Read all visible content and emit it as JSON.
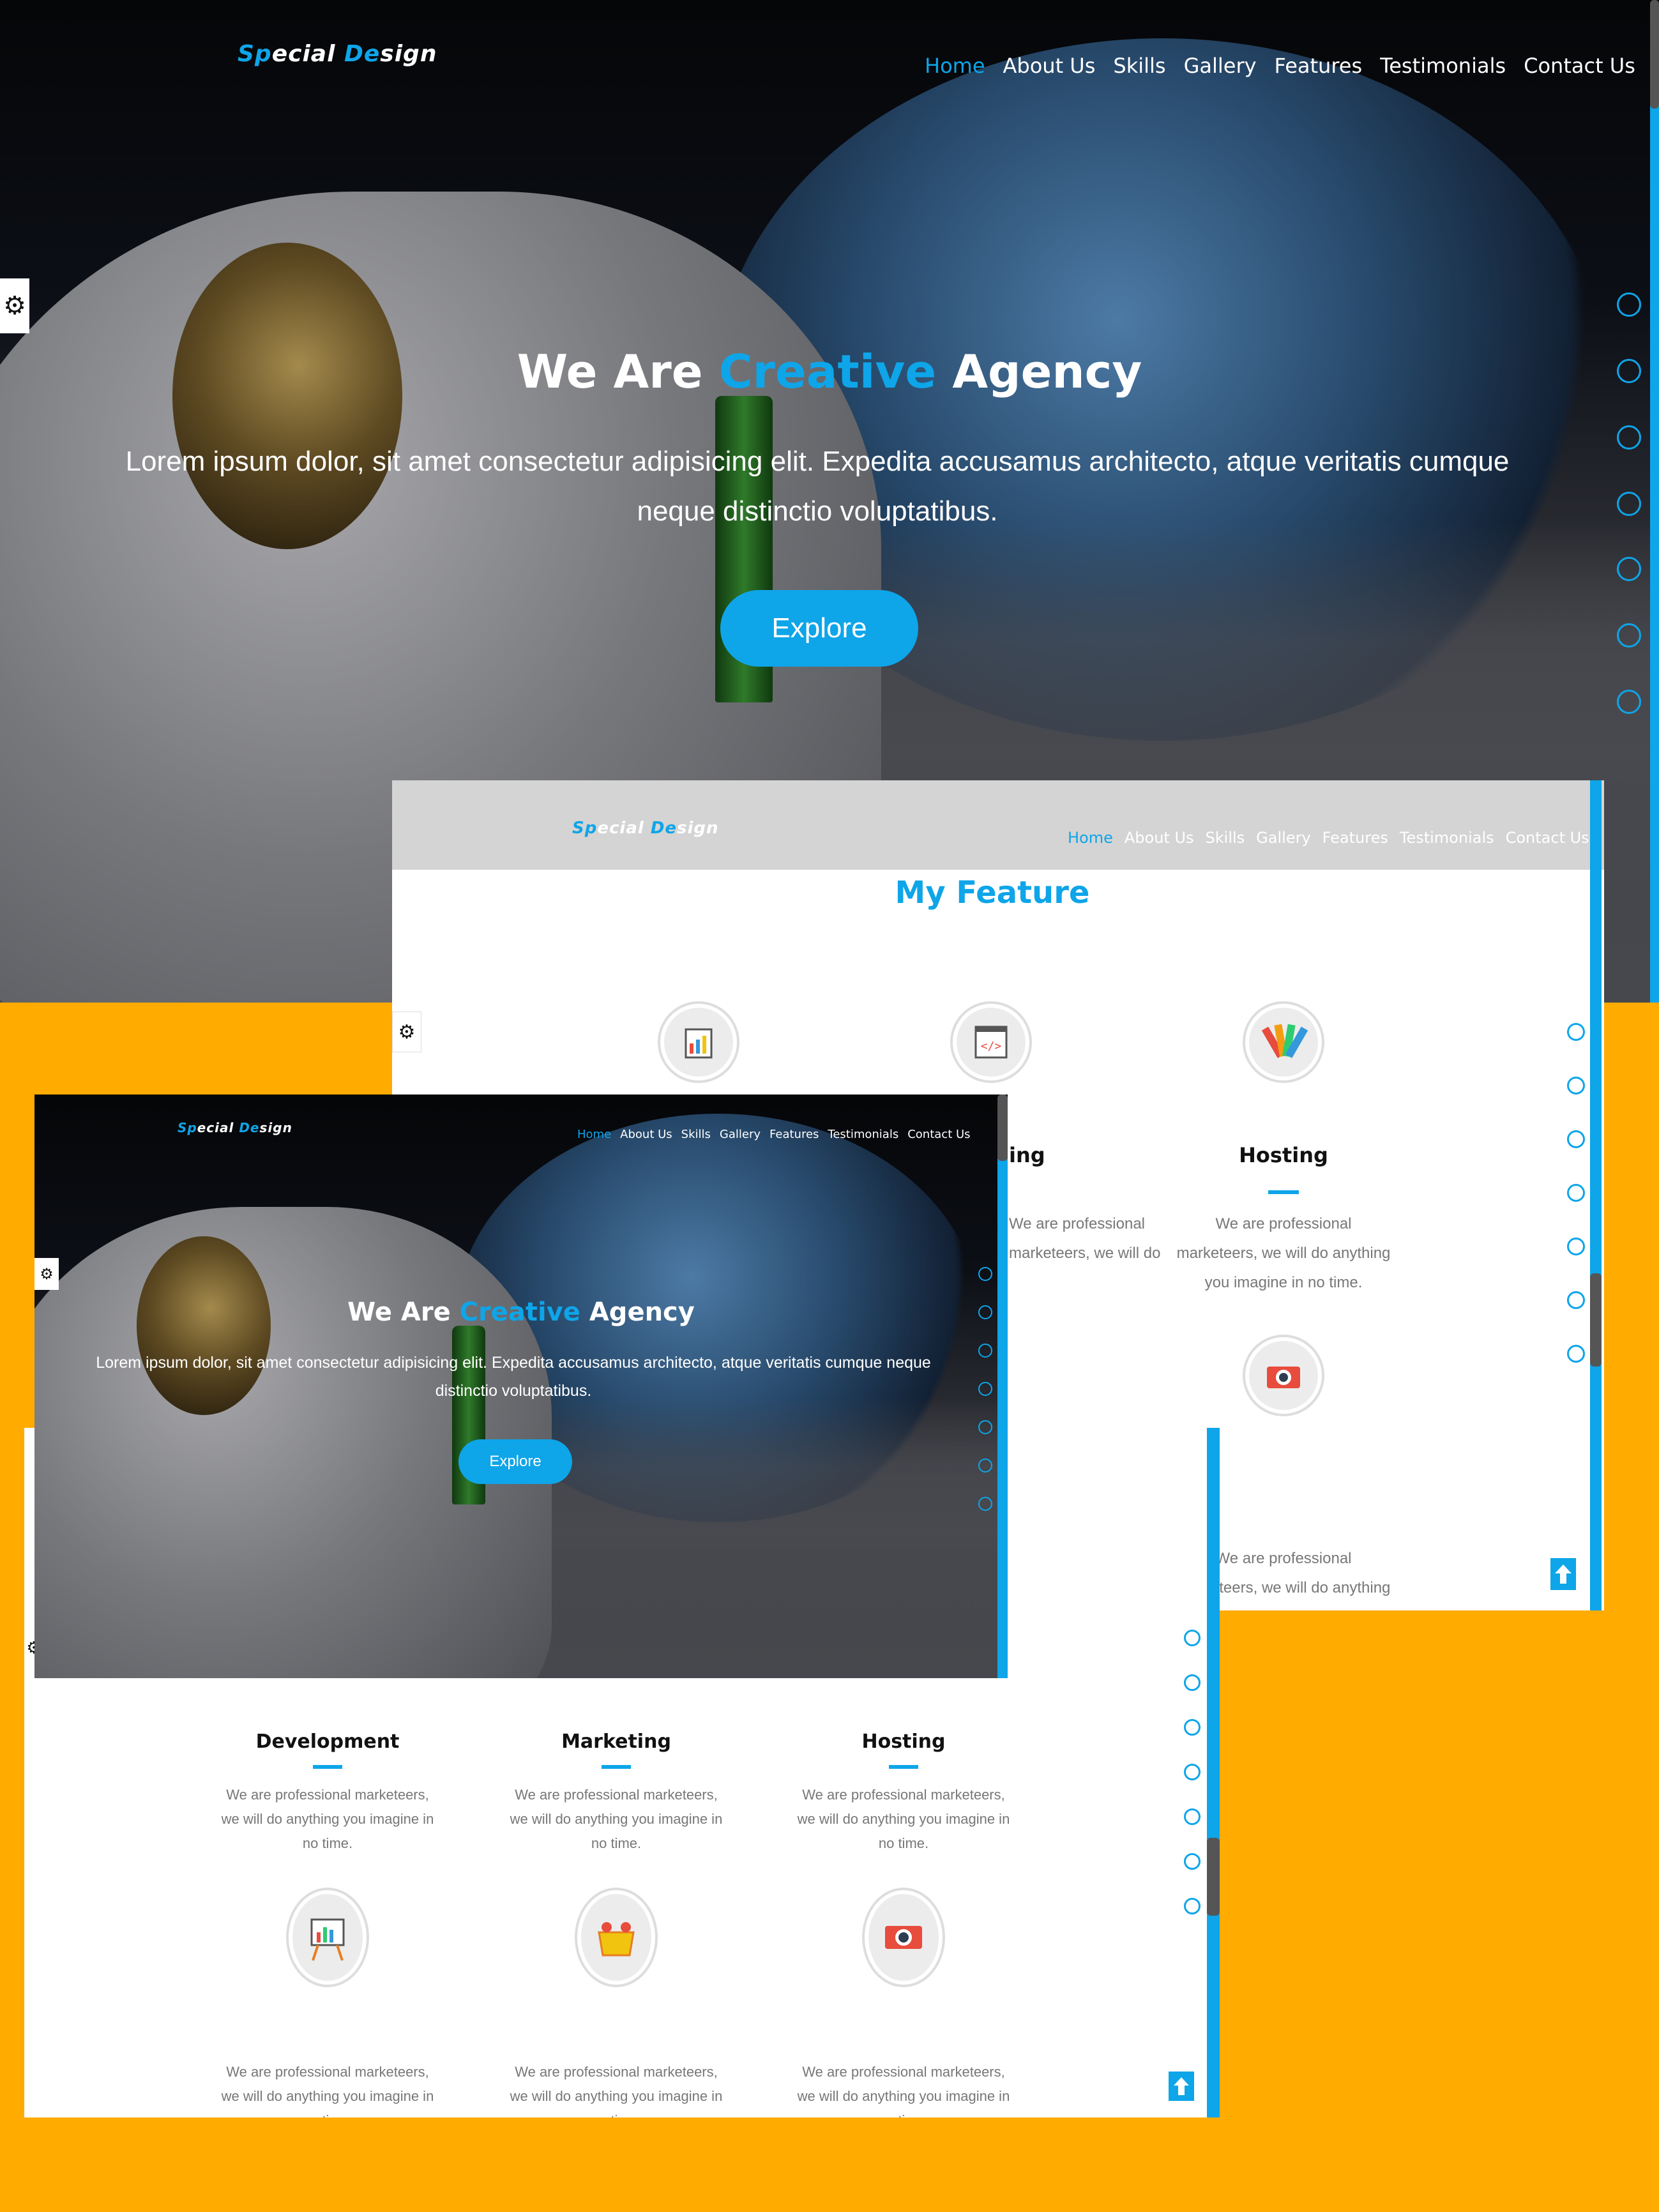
{
  "brand": {
    "logo_part1": "Sp",
    "logo_part2": "ecial ",
    "logo_part3": "De",
    "logo_part4": "sign",
    "accent": "#0ea5e9",
    "background": "#ffab00"
  },
  "nav": {
    "items": [
      "Home",
      "About Us",
      "Skills",
      "Gallery",
      "Features",
      "Testimonials",
      "Contact Us"
    ],
    "active": "Home"
  },
  "hero": {
    "title_part1": "We Are ",
    "title_accent": "Creative",
    "title_part2": " Agency",
    "description": "Lorem ipsum dolor, sit amet consectetur adipisicing elit. Expedita accusamus architecto, atque veritatis cumque neque distinctio voluptatibus.",
    "button": "Explore"
  },
  "features": {
    "heading": "My Feature",
    "items": [
      {
        "title": "Development",
        "icon": "chart-board-icon",
        "text": "We are professional marketeers, we will do anything you imagine in no time."
      },
      {
        "title": "Marketing",
        "icon": "code-window-icon",
        "text": "We are professional marketeers, we will do anything you imagine in no time."
      },
      {
        "title": "Hosting",
        "icon": "color-palette-icon",
        "text": "We are professional marketeers, we will do anything you imagine in no time."
      },
      {
        "title": "",
        "icon": "presentation-easel-icon",
        "text": "We are professional marketeers, we will do anything you imagine in no time."
      },
      {
        "title": "",
        "icon": "shopping-basket-icon",
        "text": "We are professional marketeers, we will do anything you imagine in no time."
      },
      {
        "title": "",
        "icon": "camera-icon",
        "text": "We are professional marketeers, we will do anything you imagine in no time."
      }
    ],
    "partial_title": "ing"
  },
  "icons": {
    "settings": "gear-icon",
    "scroll_top": "arrow-up-icon",
    "section_bullet": "circle-outline-icon"
  }
}
